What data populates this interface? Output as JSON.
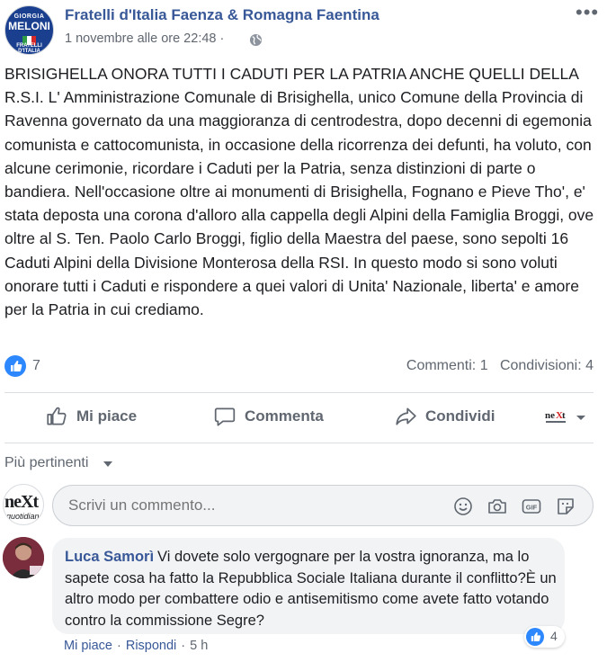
{
  "post": {
    "page_name": "Fratelli d'Italia Faenza & Romagna Faentina",
    "timestamp": "1 novembre alle ore 22:48 ·",
    "avatar_logo": {
      "top": "GIORGIA",
      "main": "MELONI",
      "sub": "FRATELLI D'ITALIA"
    },
    "text": "BRISIGHELLA ONORA TUTTI I CADUTI PER LA PATRIA ANCHE QUELLI DELLA R.S.I. L' Amministrazione Comunale di Brisighella, unico Comune della Provincia di Ravenna governato da una maggioranza di centrodestra, dopo decenni di egemonia comunista e cattocomunista, in occasione della ricorrenza dei defunti, ha voluto, con alcune cerimonie, ricordare i Caduti per la Patria, senza distinzioni di parte o bandiera. Nell'occasione oltre ai monumenti di Brisighella, Fognano e Pieve Tho', e' stata deposta una corona d'alloro alla cappella degli Alpini della Famiglia Broggi, ove oltre al S. Ten. Paolo Carlo Broggi, figlio della Maestra del paese, sono sepolti 16 Caduti Alpini della Divisione Monterosa della RSI. In questo modo si sono voluti onorare tutti i Caduti e rispondere a quei valori di Unita' Nazionale, liberta' e amore per la Patria in cui crediamo."
  },
  "stats": {
    "likes": "7",
    "comments": "Commenti: 1",
    "shares": "Condivisioni: 4"
  },
  "actions": {
    "like": "Mi piace",
    "comment": "Commenta",
    "share": "Condividi"
  },
  "sort": {
    "label": "Più pertinenti"
  },
  "composer": {
    "placeholder": "Scrivi un commento...",
    "brand": "neXt",
    "brand_sub": "quotidiano"
  },
  "comment": {
    "author": "Luca Samorì",
    "text": "Vi dovete solo vergognare per la vostra ignoranza, ma lo sapete cosa ha fatto la Repubblica Sociale Italiana durante il conflitto?È un altro modo per combattere odio e antisemitismo come avete fatto votando contro la commissione Segre?",
    "reactions": "4",
    "like_label": "Mi piace",
    "reply_label": "Rispondi",
    "age": "5 h"
  },
  "colors": {
    "link": "#385898",
    "secondary_text": "#606770",
    "like_blue": "#2d88ff",
    "bubble_bg": "#f2f3f5"
  }
}
